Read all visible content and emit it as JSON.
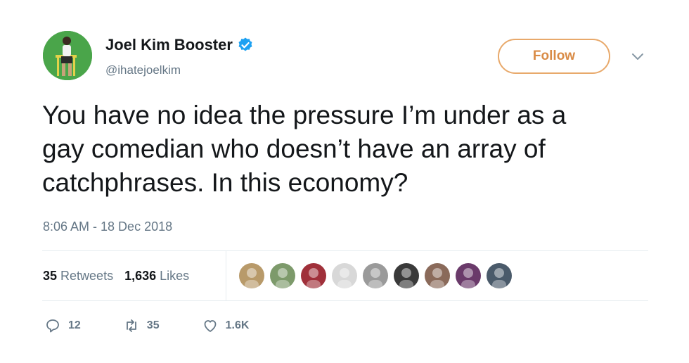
{
  "author": {
    "name": "Joel Kim Booster",
    "handle": "@ihatejoelkim"
  },
  "follow_label": "Follow",
  "tweet": {
    "lines": [
      "You have no idea the pressure I’m under as a",
      "gay comedian who doesn’t have an array of",
      "catchphrases. In this economy?"
    ],
    "timestamp": "8:06 AM - 18 Dec 2018"
  },
  "stats": {
    "retweets_count": "35",
    "retweets_label": "Retweets",
    "likes_count": "1,636",
    "likes_label": "Likes"
  },
  "likers": [
    {
      "icon": "avatar",
      "color": "#b89a6a"
    },
    {
      "icon": "avatar",
      "color": "#7d9a6b"
    },
    {
      "icon": "avatar",
      "color": "#a0303a"
    },
    {
      "icon": "avatar",
      "color": "#d8d8d8"
    },
    {
      "icon": "avatar",
      "color": "#9a9a9a"
    },
    {
      "icon": "avatar",
      "color": "#3a3a3a"
    },
    {
      "icon": "avatar",
      "color": "#8a6a5a"
    },
    {
      "icon": "avatar",
      "color": "#6a3a6a"
    },
    {
      "icon": "avatar",
      "color": "#4a5a6a"
    }
  ],
  "actions": {
    "reply_count": "12",
    "retweet_count": "35",
    "like_count": "1.6K"
  },
  "colors": {
    "follow_border": "#e8a96b",
    "follow_text": "#d98b46",
    "verified": "#1da1f2",
    "muted": "#657786"
  }
}
